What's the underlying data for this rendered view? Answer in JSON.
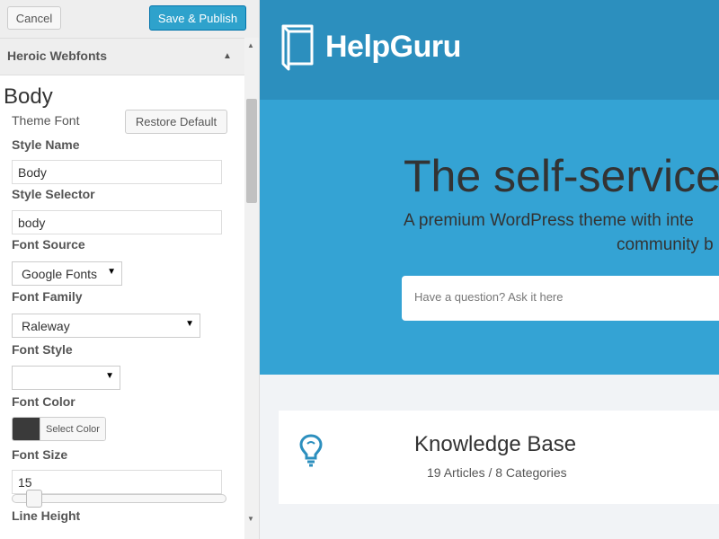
{
  "customizer": {
    "cancel_label": "Cancel",
    "publish_label": "Save & Publish",
    "section_title": "Heroic Webfonts",
    "panel_heading": "Body",
    "theme_font_label": "Theme Font",
    "restore_label": "Restore Default",
    "style_name_label": "Style Name",
    "style_name_value": "Body",
    "style_selector_label": "Style Selector",
    "style_selector_value": "body",
    "font_source_label": "Font Source",
    "font_source_value": "Google Fonts",
    "font_family_label": "Font Family",
    "font_family_value": "Raleway",
    "font_style_label": "Font Style",
    "font_style_value": "",
    "font_color_label": "Font Color",
    "font_color_value": "#3a3a3a",
    "select_color_label": "Select Color",
    "font_size_label": "Font Size",
    "font_size_value": "15",
    "line_height_label": "Line Height"
  },
  "preview": {
    "site_name": "HelpGuru",
    "hero_title": "The self-service",
    "hero_subtitle_line1": "A premium WordPress theme with inte",
    "hero_subtitle_line2": "community b",
    "search_placeholder": "Have a question? Ask it here",
    "kb_title": "Knowledge Base",
    "kb_meta": "19 Articles / 8 Categories"
  },
  "colors": {
    "accent": "#2ea2cc",
    "header_bg": "#2c8fbe",
    "hero_bg": "#34a3d4",
    "body_bg": "#f1f3f6"
  },
  "icons": [
    "book-logo-icon",
    "lightbulb-icon",
    "collapse-arrow-icon",
    "dropdown-caret-icon"
  ]
}
